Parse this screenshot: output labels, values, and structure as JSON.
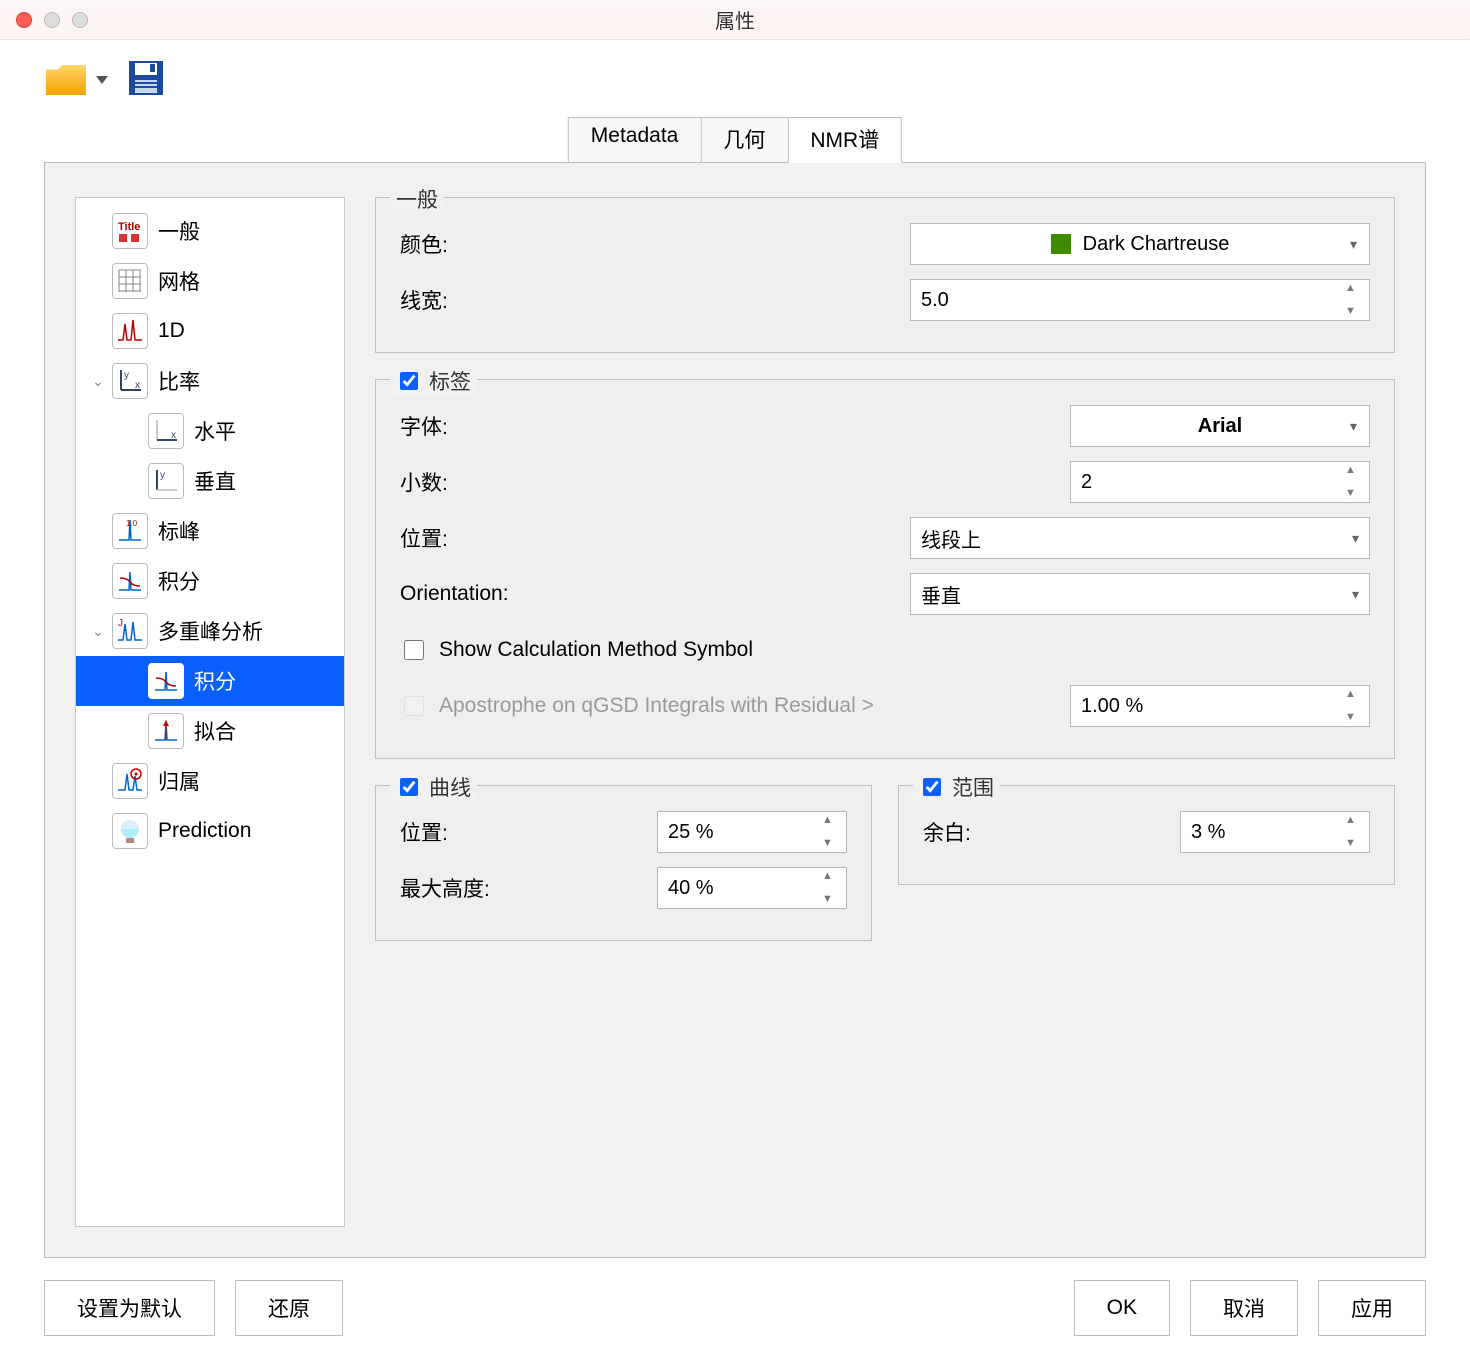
{
  "window": {
    "title": "属性"
  },
  "tabs": {
    "metadata": "Metadata",
    "geometry": "几何",
    "nmr": "NMR谱"
  },
  "activeTab": "NMR谱",
  "tree": {
    "general": "一般",
    "grid": "网格",
    "oneD": "1D",
    "ratio": "比率",
    "horizontal": "水平",
    "vertical": "垂直",
    "peaks": "标峰",
    "integrals": "积分",
    "multiplets": "多重峰分析",
    "mIntegrals": "积分",
    "fitting": "拟合",
    "assignment": "归属",
    "prediction": "Prediction"
  },
  "selectedNode": "mIntegrals",
  "general": {
    "title": "一般",
    "colorLabel": "颜色:",
    "colorValue": "Dark Chartreuse",
    "colorHex": "#3d8b00",
    "lineWidthLabel": "线宽:",
    "lineWidthValue": "5.0"
  },
  "labels": {
    "title": "标签",
    "enabled": true,
    "fontLabel": "字体:",
    "fontValue": "Arial",
    "decimalsLabel": "小数:",
    "decimalsValue": "2",
    "positionLabel": "位置:",
    "positionValue": "线段上",
    "orientationLabel": "Orientation:",
    "orientationValue": "垂直",
    "showCalcLabel": "Show Calculation Method Symbol",
    "showCalcChecked": false,
    "apostropheLabel": "Apostrophe on qGSD Integrals with Residual >",
    "apostropheEnabled": false,
    "apostropheValue": "1.00 %"
  },
  "curve": {
    "title": "曲线",
    "enabled": true,
    "positionLabel": "位置:",
    "positionValue": "25 %",
    "maxHeightLabel": "最大高度:",
    "maxHeightValue": "40 %"
  },
  "range": {
    "title": "范围",
    "enabled": true,
    "marginLabel": "余白:",
    "marginValue": "3 %"
  },
  "buttons": {
    "setDefault": "设置为默认",
    "revert": "还原",
    "ok": "OK",
    "cancel": "取消",
    "apply": "应用"
  }
}
